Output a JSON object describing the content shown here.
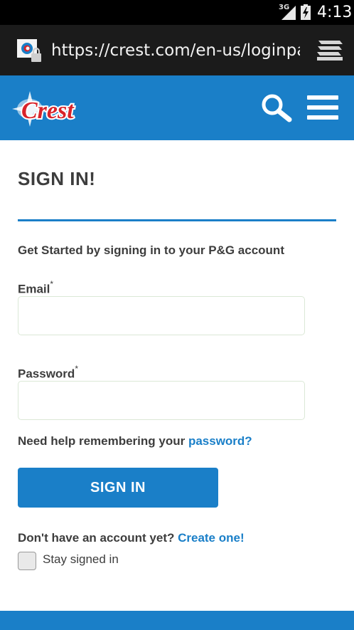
{
  "status_bar": {
    "network": "3G",
    "time": "4:13"
  },
  "browser": {
    "url": "https://crest.com/en-us/loginpa"
  },
  "header": {
    "logo_text": "Crest",
    "brand_color": "#1a7fc8"
  },
  "page": {
    "title": "SIGN IN!",
    "intro": "Get Started by signing in to your P&G account"
  },
  "form": {
    "email_label": "Email",
    "email_required": "*",
    "email_value": "",
    "password_label": "Password",
    "password_required": "*",
    "password_value": "",
    "help_text": "Need help remembering your ",
    "help_link": "password?",
    "submit_label": "SIGN IN",
    "account_text": "Don't have an account yet? ",
    "account_link": "Create one!",
    "stay_signed_in_label": "Stay signed in",
    "stay_signed_in_checked": false
  },
  "icons": {
    "search": "search-icon",
    "menu": "hamburger-menu-icon",
    "tabs": "tabs-icon",
    "site": "site-security-icon"
  }
}
